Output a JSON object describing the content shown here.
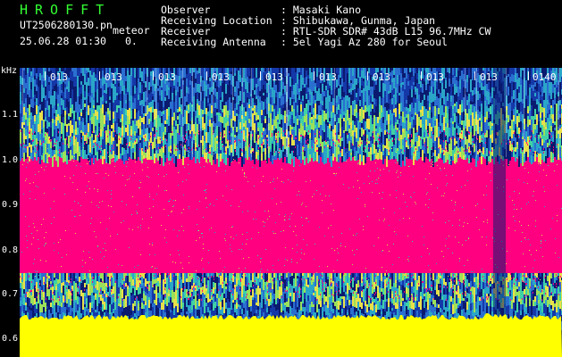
{
  "header": {
    "title": "HROFFT",
    "filename": "UT2506280130.pn",
    "meteor_label": "meteor",
    "datetime": "25.06.28 01:30",
    "count": "0."
  },
  "info": {
    "labels": [
      "Observer",
      "Receiving Location",
      "Receiver",
      "Receiving Antenna"
    ],
    "values": [
      ": Masaki Kano",
      ": Shibukawa, Gunma, Japan",
      ": RTL-SDR SDR# 43dB L15 96.7MHz CW",
      ": 5el Yagi Az 280 for Seoul"
    ]
  },
  "y_axis": {
    "unit": "kHz",
    "labels": [
      "1.1",
      "1.0",
      "0.9",
      "0.8",
      "0.7",
      "0.6"
    ]
  },
  "x_axis": {
    "labels": [
      "013",
      "013",
      "013",
      "013",
      "013",
      "013",
      "013",
      "013",
      "013",
      "0140"
    ]
  },
  "colors": {
    "background": "#000000",
    "strong_signal": "#ff0080",
    "noise_floor": "#ffff00",
    "title": "#33ff33",
    "text": "#ffffff"
  }
}
